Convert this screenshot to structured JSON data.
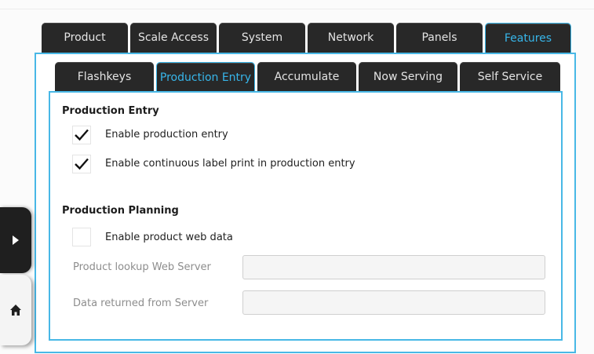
{
  "main_tabs": [
    {
      "label": "Product"
    },
    {
      "label": "Scale Access"
    },
    {
      "label": "System"
    },
    {
      "label": "Network"
    },
    {
      "label": "Panels"
    },
    {
      "label": "Features",
      "active": true
    }
  ],
  "sub_tabs": [
    {
      "label": "Flashkeys"
    },
    {
      "label": "Production Entry",
      "active": true
    },
    {
      "label": "Accumulate"
    },
    {
      "label": "Now Serving"
    },
    {
      "label": "Self Service"
    }
  ],
  "production_entry": {
    "title": "Production Entry",
    "options": [
      {
        "label": "Enable production entry",
        "checked": true
      },
      {
        "label": "Enable continuous label print in production entry",
        "checked": true
      }
    ]
  },
  "production_planning": {
    "title": "Production Planning",
    "web_data": {
      "label": "Enable product web data",
      "checked": false
    },
    "lookup_server": {
      "label": "Product lookup Web Server",
      "value": ""
    },
    "data_returned": {
      "label": "Data returned from Server",
      "value": ""
    }
  },
  "side_nav": {
    "expand_icon": "play-arrow-icon",
    "home_icon": "home-icon"
  },
  "colors": {
    "accent": "#37b6ea",
    "tab_bg": "#282828",
    "panel_border": "#48b8e6"
  }
}
